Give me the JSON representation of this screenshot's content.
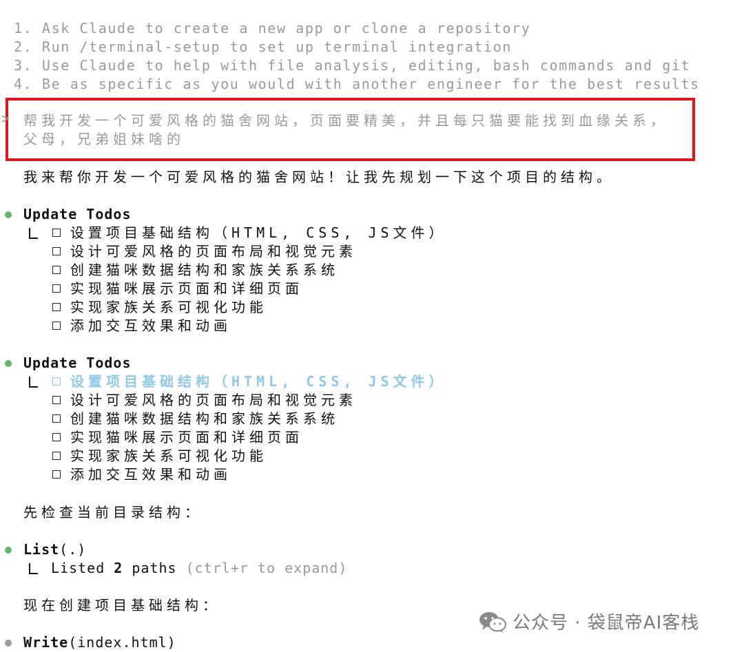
{
  "tips": [
    "1. Ask Claude to create a new app or clone a repository",
    "2. Run /terminal-setup to set up terminal integration",
    "3. Use Claude to help with file analysis, editing, bash commands and git",
    "4. Be as specific as you would with another engineer for the best results"
  ],
  "prompt": {
    "chevron": ">",
    "line1": "帮我开发一个可爱风格的猫舍网站，页面要精美，并且每只猫要能找到血缘关系，",
    "line2": "父母，兄弟姐妹啥的"
  },
  "reply_intro": "我来帮你开发一个可爱风格的猫舍网站！让我先规划一下这个项目的结构。",
  "todo_block_1": {
    "title": "Update Todos",
    "items": [
      "设置项目基础结构（HTML, CSS, JS文件）",
      "设计可爱风格的页面布局和视觉元素",
      "创建猫咪数据结构和家族关系系统",
      "实现猫咪展示页面和详细页面",
      "实现家族关系可视化功能",
      "添加交互效果和动画"
    ]
  },
  "todo_block_2": {
    "title": "Update Todos",
    "items": [
      "设置项目基础结构（HTML, CSS, JS文件）",
      "设计可爱风格的页面布局和视觉元素",
      "创建猫咪数据结构和家族关系系统",
      "实现猫咪展示页面和详细页面",
      "实现家族关系可视化功能",
      "添加交互效果和动画"
    ]
  },
  "check_dir_text": "先检查当前目录结构：",
  "list_tool": {
    "name": "List",
    "arg": "(.)",
    "result_prefix": "Listed ",
    "result_count": "2",
    "result_suffix": " paths ",
    "result_hint": "(ctrl+r to expand)"
  },
  "create_text": "现在创建项目基础结构：",
  "write_tool": {
    "name": "Write",
    "arg": "(index.html)"
  },
  "watermark": {
    "text": "公众号 · 袋鼠帝AI客栈",
    "icon": "wechat-icon"
  },
  "colors": {
    "accent_dot": "#5dbb63",
    "active_todo": "#8ec8ea",
    "highlight_border": "#e3151b",
    "dim_text": "#9a9a9a"
  }
}
